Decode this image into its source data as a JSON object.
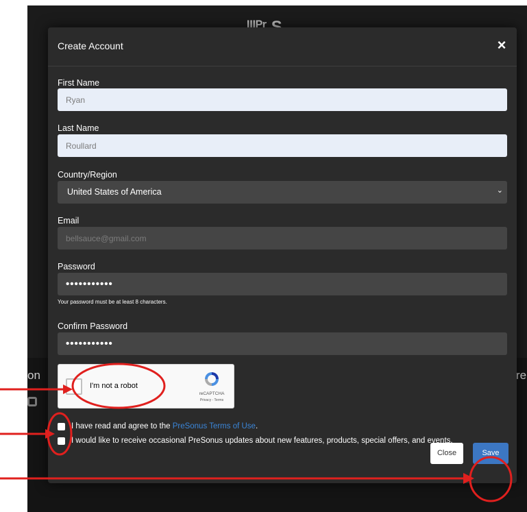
{
  "background": {
    "logo_text": "ᴵᴵᴵᴾʳ  S",
    "left_fragment": "on",
    "right_fragment": "re"
  },
  "modal": {
    "title": "Create Account",
    "close_glyph": "×"
  },
  "form": {
    "first_name": {
      "label": "First Name",
      "value": "Ryan"
    },
    "last_name": {
      "label": "Last Name",
      "value": "Roullard"
    },
    "country": {
      "label": "Country/Region",
      "value": "United States of America"
    },
    "email": {
      "label": "Email",
      "value": "bellsauce@gmail.com"
    },
    "password": {
      "label": "Password",
      "value": "•••••••••••",
      "hint": "Your password must be at least 8 characters."
    },
    "confirm_password": {
      "label": "Confirm Password",
      "value": "•••••••••••"
    }
  },
  "captcha": {
    "label": "I'm not a robot",
    "brand": "reCAPTCHA",
    "links": "Privacy - Terms"
  },
  "checkboxes": {
    "terms_prefix": "I have read and agree to the ",
    "terms_link": "PreSonus Terms of Use",
    "terms_suffix": ".",
    "updates": "I would like to receive occasional PreSonus updates about new features, products, special offers, and events."
  },
  "buttons": {
    "close_label": "Close",
    "save_label": "Save"
  },
  "colors": {
    "annotation_red": "#e0201e",
    "save_blue": "#3c77c3",
    "link_blue": "#3b86d8"
  }
}
